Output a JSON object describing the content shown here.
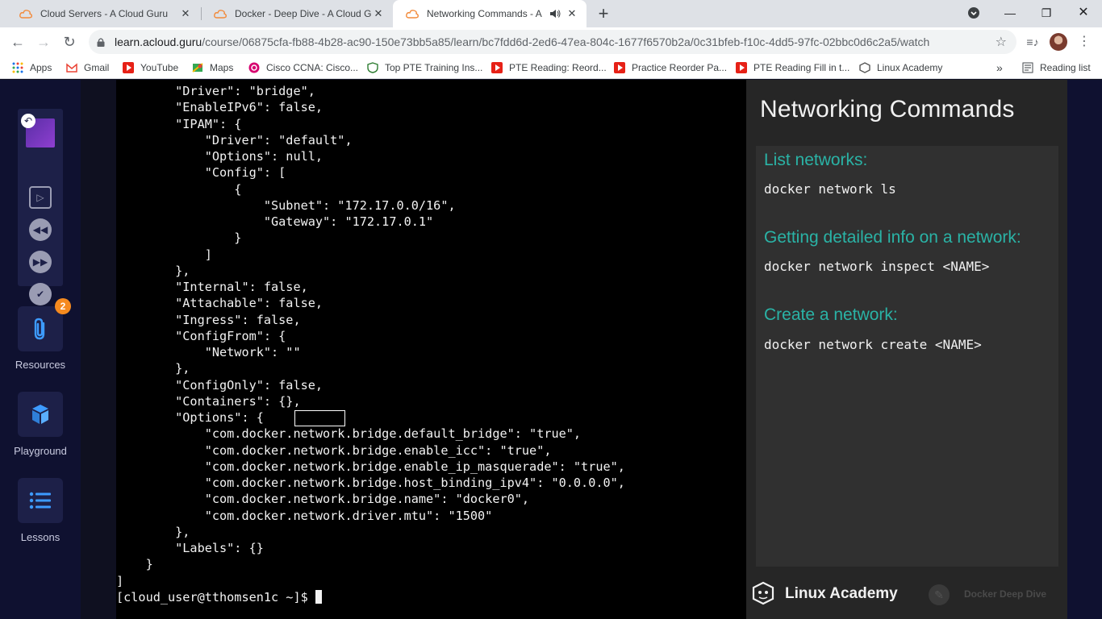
{
  "browser": {
    "tabs": [
      {
        "title": "Cloud Servers - A Cloud Guru",
        "active": false
      },
      {
        "title": "Docker - Deep Dive - A Cloud Gu",
        "active": false
      },
      {
        "title": "Networking Commands - A C",
        "active": true
      }
    ],
    "new_tab": "+",
    "url_host": "learn.acloud.guru",
    "url_path": "/course/06875cfa-fb88-4b28-ac90-150e73bb5a85/learn/bc7fdd6d-2ed6-47ea-804c-1677f6570b2a/0c31bfeb-f10c-4dd5-97fc-02bbc0d6c2a5/watch",
    "bookmarks": [
      "Apps",
      "Gmail",
      "YouTube",
      "Maps",
      "Cisco CCNA: Cisco...",
      "Top PTE Training Ins...",
      "PTE Reading: Reord...",
      "Practice Reorder Pa...",
      "PTE Reading Fill in t...",
      "Linux Academy"
    ],
    "bookmarks_overflow": "»",
    "reading_list": "Reading list"
  },
  "sidebar": {
    "resources_label": "Resources",
    "resources_badge": "2",
    "playground_label": "Playground",
    "lessons_label": "Lessons"
  },
  "terminal": {
    "lines": [
      "        \"Driver\": \"bridge\",",
      "        \"EnableIPv6\": false,",
      "        \"IPAM\": {",
      "            \"Driver\": \"default\",",
      "            \"Options\": null,",
      "            \"Config\": [",
      "                {",
      "                    \"Subnet\": \"172.17.0.0/16\",",
      "                    \"Gateway\": \"172.17.0.1\"",
      "                }",
      "            ]",
      "        },",
      "        \"Internal\": false,",
      "        \"Attachable\": false,",
      "        \"Ingress\": false,",
      "        \"ConfigFrom\": {",
      "            \"Network\": \"\"",
      "        },",
      "        \"ConfigOnly\": false,",
      "        \"Containers\": {},",
      "        \"Options\": {",
      "            \"com.docker.network.bridge.default_bridge\": \"true\",",
      "            \"com.docker.network.bridge.enable_icc\": \"true\",",
      "            \"com.docker.network.bridge.enable_ip_masquerade\": \"true\",",
      "            \"com.docker.network.bridge.host_binding_ipv4\": \"0.0.0.0\",",
      "            \"com.docker.network.bridge.name\": \"docker0\",",
      "            \"com.docker.network.driver.mtu\": \"1500\"",
      "        },",
      "        \"Labels\": {}",
      "    }",
      "]"
    ],
    "prompt": "[cloud_user@tthomsen1c ~]$ "
  },
  "slide": {
    "title": "Networking Commands",
    "sections": [
      {
        "heading": "List networks:",
        "command": "docker network ls"
      },
      {
        "heading": "Getting detailed info on a network:",
        "command": "docker network inspect <NAME>"
      },
      {
        "heading": "Create a network:",
        "command": "docker network create <NAME>"
      }
    ],
    "brand": "Linux Academy",
    "course": "Docker Deep Dive"
  }
}
